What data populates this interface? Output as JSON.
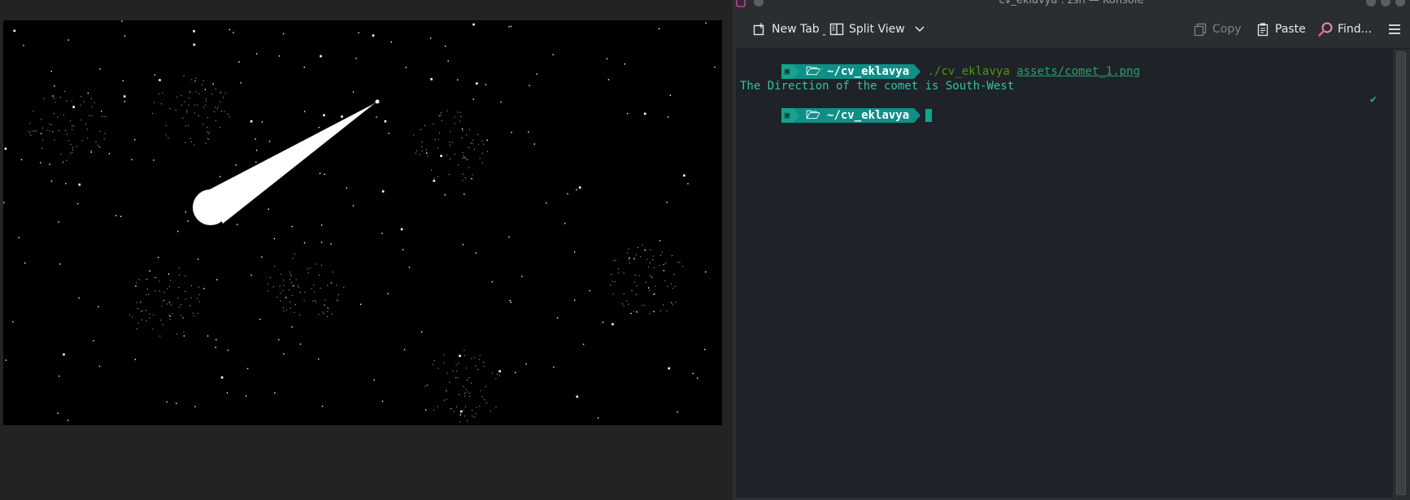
{
  "window": {
    "title": "cv_eklavya : zsh — Konsole"
  },
  "toolbar": {
    "new_tab": "New Tab",
    "split_view": "Split View",
    "copy": "Copy",
    "paste": "Paste",
    "find": "Find..."
  },
  "terminal": {
    "prompt_dir": "~/cv_eklavya",
    "command": "./cv_eklavya",
    "argument": "assets/comet_1.png",
    "output": "The Direction of the comet is South-West",
    "status_check": "✔"
  },
  "colors": {
    "accent": "#12a58b",
    "terminal_bg": "#1f2229",
    "prompt_path_bg": "#0f8f88"
  },
  "icons": {
    "new_tab": "new-tab-icon",
    "split_view": "split-view-icon",
    "copy": "copy-icon",
    "paste": "paste-icon",
    "find": "find-icon",
    "menu": "hamburger-menu-icon",
    "folder": "folder-icon"
  }
}
